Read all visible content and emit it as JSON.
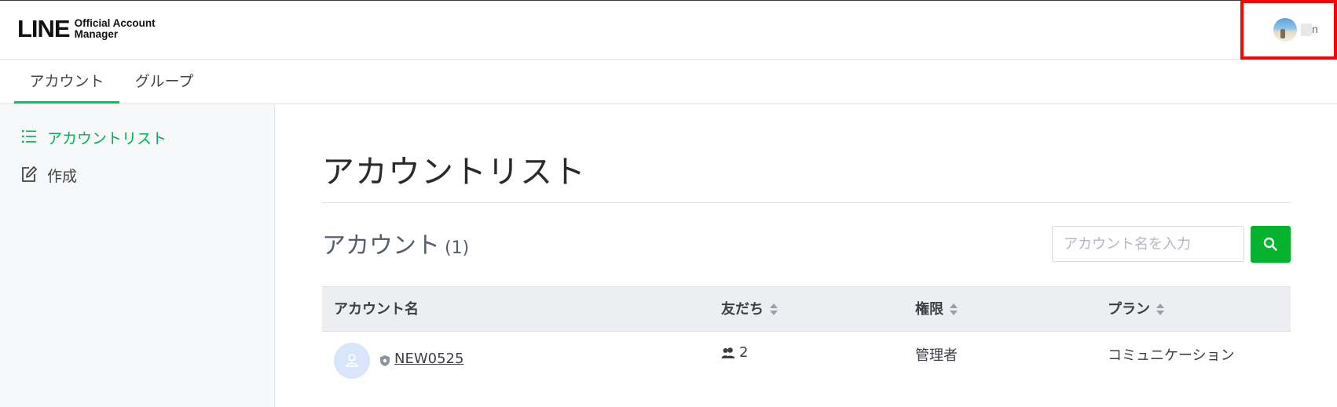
{
  "header": {
    "logo_mark": "LINE",
    "logo_line1": "Official Account",
    "logo_line2": "Manager",
    "user_name_suffix": "n"
  },
  "tabs": [
    {
      "label": "アカウント",
      "active": true
    },
    {
      "label": "グループ",
      "active": false
    }
  ],
  "sidebar": {
    "items": [
      {
        "label": "アカウントリスト",
        "icon": "list-icon",
        "active": true
      },
      {
        "label": "作成",
        "icon": "edit-icon",
        "active": false
      }
    ]
  },
  "main": {
    "page_title": "アカウントリスト",
    "section_title": "アカウント",
    "section_count": "(1)",
    "search": {
      "placeholder": "アカウント名を入力",
      "value": ""
    },
    "table": {
      "columns": [
        "アカウント名",
        "友だち",
        "権限",
        "プラン"
      ],
      "rows": [
        {
          "name": "NEW0525",
          "friends": "2",
          "role": "管理者",
          "plan": "コミュニケーション"
        }
      ]
    }
  },
  "colors": {
    "accent": "#06c755",
    "search_button": "#06b32e",
    "highlight_box": "#ff0000"
  }
}
